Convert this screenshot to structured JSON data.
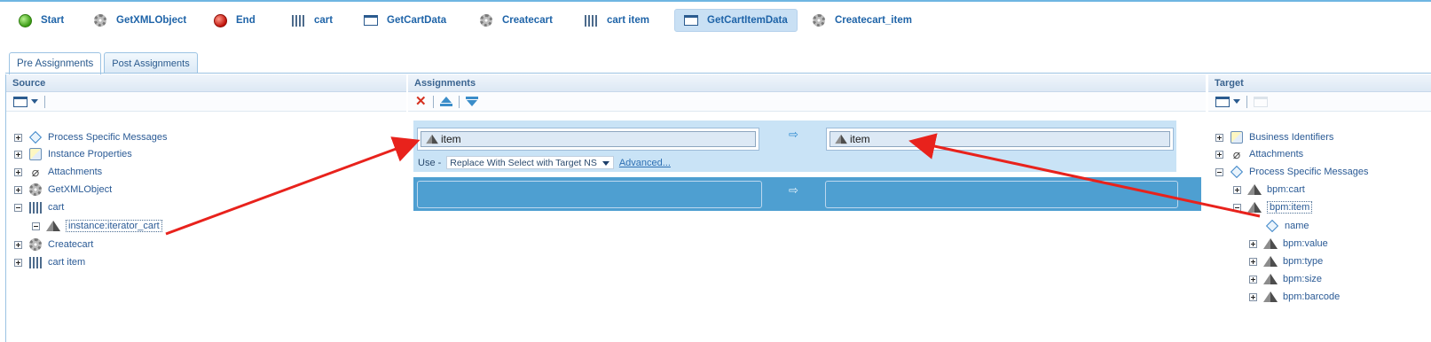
{
  "flow": {
    "items": [
      {
        "label": "Start",
        "icon": "green-start-circle-icon"
      },
      {
        "label": "GetXMLObject",
        "icon": "gear-icon"
      },
      {
        "label": "End",
        "icon": "red-end-circle-icon"
      },
      {
        "label": "cart",
        "icon": "iterator-bars-icon"
      },
      {
        "label": "GetCartData",
        "icon": "window-icon"
      },
      {
        "label": "Createcart",
        "icon": "gear-icon"
      },
      {
        "label": "cart item",
        "icon": "iterator-bars-icon"
      },
      {
        "label": "GetCartItemData",
        "icon": "window-icon"
      },
      {
        "label": "Createcart_item",
        "icon": "gear-icon"
      }
    ],
    "active": "GetCartItemData"
  },
  "tabs": {
    "pre": "Pre Assignments",
    "post": "Post Assignments",
    "active": "Pre Assignments"
  },
  "source": {
    "title": "Source",
    "tree": [
      {
        "label": "Process Specific Messages",
        "expander": "plus",
        "icon": "diamond-icon"
      },
      {
        "label": "Instance Properties",
        "expander": "plus",
        "icon": "properties-icon"
      },
      {
        "label": "Attachments",
        "expander": "plus",
        "icon": "paperclip-icon"
      },
      {
        "label": "GetXMLObject",
        "expander": "plus",
        "icon": "gear-icon"
      },
      {
        "label": "cart",
        "expander": "minus",
        "icon": "iterator-bars-icon"
      },
      {
        "label": "instance:iterator_cart",
        "expander": "minus",
        "icon": "pyramid-icon",
        "selected": true
      },
      {
        "label": "Createcart",
        "expander": "plus",
        "icon": "gear-icon"
      },
      {
        "label": "cart item",
        "expander": "plus",
        "icon": "iterator-bars-icon"
      }
    ]
  },
  "assignments": {
    "title": "Assignments",
    "row1": {
      "source_value": "item",
      "target_value": "item",
      "use_label": "Use -",
      "use_option": "Replace With Select with Target NS",
      "advanced_link": "Advanced..."
    }
  },
  "target": {
    "title": "Target",
    "tree": [
      {
        "label": "Business Identifiers",
        "expander": "plus",
        "icon": "properties-icon"
      },
      {
        "label": "Attachments",
        "expander": "plus",
        "icon": "paperclip-icon"
      },
      {
        "label": "Process Specific Messages",
        "expander": "minus",
        "icon": "diamond-icon"
      },
      {
        "label": "bpm:cart",
        "expander": "plus",
        "icon": "pyramid-icon"
      },
      {
        "label": "bpm:item",
        "expander": "minus",
        "icon": "pyramid-icon",
        "selected": true
      },
      {
        "label": "name",
        "expander": "none",
        "icon": "diamond-icon"
      },
      {
        "label": "bpm:value",
        "expander": "plus",
        "icon": "pyramid-icon"
      },
      {
        "label": "bpm:type",
        "expander": "plus",
        "icon": "pyramid-icon"
      },
      {
        "label": "bpm:size",
        "expander": "plus",
        "icon": "pyramid-icon"
      },
      {
        "label": "bpm:barcode",
        "expander": "plus",
        "icon": "pyramid-icon"
      }
    ]
  },
  "colors": {
    "accent": "#1f64a8",
    "annotation_arrow": "#e8221c",
    "row_selected": "#c9e3f6",
    "row_empty": "#4e9fd1"
  }
}
